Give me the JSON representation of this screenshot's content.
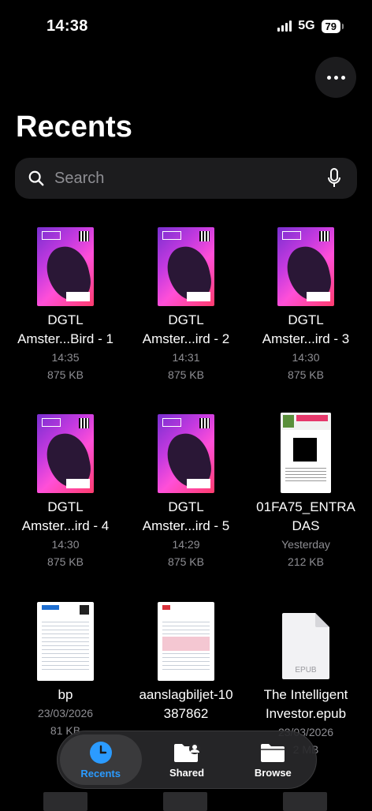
{
  "status_bar": {
    "time": "14:38",
    "network": "5G",
    "battery": "79"
  },
  "header": {
    "title": "Recents",
    "more_icon": "ellipsis-icon"
  },
  "search": {
    "placeholder": "Search"
  },
  "files": [
    {
      "name": "DGTL\nAmster...Bird - 1",
      "date": "14:35",
      "size": "875 KB",
      "thumb": "poster"
    },
    {
      "name": "DGTL\nAmster...ird - 2",
      "date": "14:31",
      "size": "875 KB",
      "thumb": "poster"
    },
    {
      "name": "DGTL\nAmster...ird - 3",
      "date": "14:30",
      "size": "875 KB",
      "thumb": "poster"
    },
    {
      "name": "DGTL\nAmster...ird - 4",
      "date": "14:30",
      "size": "875 KB",
      "thumb": "poster"
    },
    {
      "name": "DGTL\nAmster...ird - 5",
      "date": "14:29",
      "size": "875 KB",
      "thumb": "poster"
    },
    {
      "name": "01FA75_ENTRA\nDAS",
      "date": "Yesterday",
      "size": "212 KB",
      "thumb": "ticket"
    },
    {
      "name": "bp",
      "date": "23/03/2026",
      "size": "81 KB",
      "thumb": "boarding-pass"
    },
    {
      "name": "aanslagbiljet-10\n387862",
      "date": "",
      "size": "",
      "thumb": "document"
    },
    {
      "name": "The Intelligent\nInvestor.epub",
      "date": "23/03/2026",
      "size": "2 MB",
      "thumb": "epub",
      "type_label": "EPUB"
    }
  ],
  "tabs": [
    {
      "label": "Recents",
      "icon": "clock-icon",
      "active": true
    },
    {
      "label": "Shared",
      "icon": "shared-folder-icon",
      "active": false
    },
    {
      "label": "Browse",
      "icon": "folder-icon",
      "active": false
    }
  ],
  "colors": {
    "accent": "#2b9bff",
    "background": "#000000",
    "secondary_text": "#8e8e93"
  }
}
